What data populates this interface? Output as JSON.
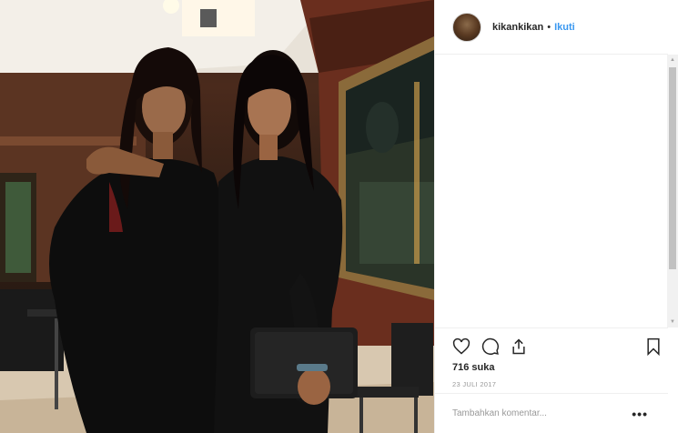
{
  "post": {
    "username": "kikankikan",
    "separator": "•",
    "follow_label": "Ikuti",
    "likes_text": "716 suka",
    "date_text": "23 JULI 2017",
    "comment_placeholder": "Tambahkan komentar...",
    "more_label": "•••"
  },
  "icons": {
    "like": "heart-icon",
    "comment": "comment-icon",
    "share": "share-icon",
    "save": "bookmark-icon"
  },
  "colors": {
    "follow": "#3897f0",
    "text": "#262626",
    "muted": "#999999"
  }
}
